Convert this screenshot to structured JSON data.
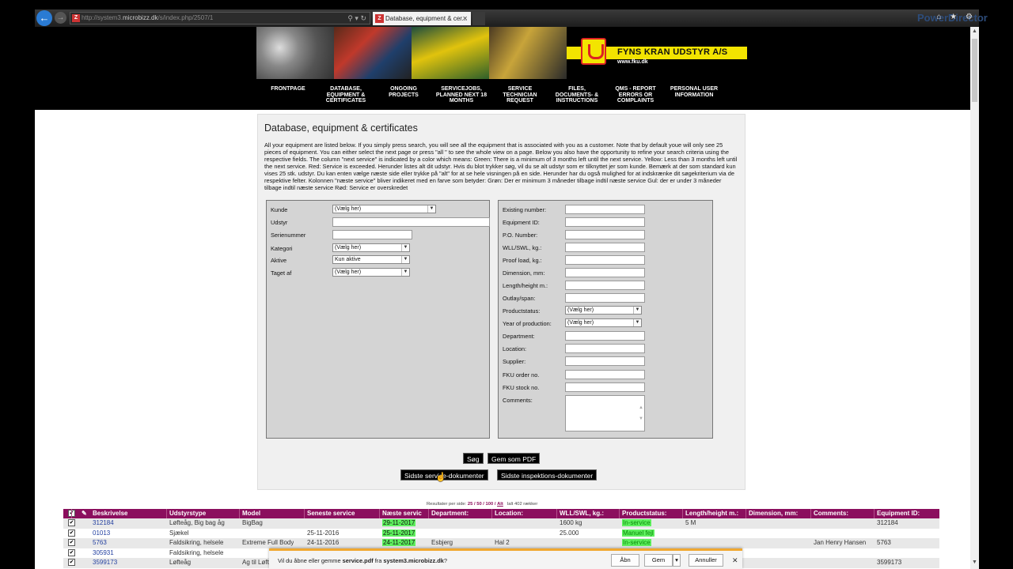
{
  "browser": {
    "url_prefix": "http://system3.",
    "url_domain": "microbizz.dk",
    "url_suffix": "/s/index.php/2507/1",
    "tab_title": "Database, equipment & cer...",
    "favicon": "Z",
    "tools_glyphs": "⚲ ▾ ↻",
    "close_glyph": "✕",
    "back_glyph": "←",
    "forward_glyph": "→",
    "chrome_icons": "⌂ ★ ⚙",
    "background_app_label": "PowerDirector"
  },
  "site": {
    "company_name": "FYNS KRAN UDSTYR A/S",
    "company_url": "www.fku.dk",
    "menu": [
      {
        "label": "FRONTPAGE"
      },
      {
        "label": "DATABASE, EQUIPMENT & CERTIFICATES"
      },
      {
        "label": "ONGOING PROJECTS"
      },
      {
        "label": "SERVICEJOBS, PLANNED NEXT 18 MONTHS"
      },
      {
        "label": "SERVICE TECHNICIAN REQUEST"
      },
      {
        "label": "FILES, DOCUMENTS- & INSTRUCTIONS"
      },
      {
        "label": "QMS - REPORT ERRORS OR COMPLAINTS"
      },
      {
        "label": "PERSONAL USER INFORMATION"
      }
    ]
  },
  "panel": {
    "title": "Database, equipment & certificates",
    "intro": "All your equipment are listed below. If you simply press search, you will see all the equipment that is associated with you as a customer. Note that by default youe will only see 25 pieces of equipment. You can either select the next page or press \"all \" to see the whole view on a page. Below you also have the opportunity to refine your search criteria using the respective fields. The column \"next service\" is indicated by a color which means: Green: There is a minimum of 3 months left until the next service. Yellow: Less than 3 months left until the next service. Red: Service is exceeded. Herunder listes alt dit udstyr. Hvis du blot trykker søg, vil du se alt udstyr som er tilknyttet jer som kunde. Bemærk at der som standard kun vises 25 stk. udstyr. Du kan enten vælge næste side eller trykke på \"alt\" for at se hele visningen på en side. Herunder har du også mulighed for at indskrænke dit søgekriterium via de respektive felter. Kolonnen \"næste service\" bliver indikeret med en farve som betyder: Grøn: Der er minimum 3 måneder tilbage indtil næste service Gul: der er under 3 måneder tilbage indtil næste service Rød: Service er overskredet"
  },
  "form_left": [
    {
      "label": "Kunde",
      "type": "select",
      "value": "(Vælg her)"
    },
    {
      "label": "Udstyr",
      "type": "input",
      "value": ""
    },
    {
      "label": "Serienummer",
      "type": "input",
      "value": ""
    },
    {
      "label": "Kategori",
      "type": "select",
      "value": "(Vælg her)"
    },
    {
      "label": "Aktive",
      "type": "select",
      "value": "Kun aktive"
    },
    {
      "label": "Taget af",
      "type": "select",
      "value": "(Vælg her)"
    }
  ],
  "form_right": [
    {
      "label": "Existing number:",
      "type": "input",
      "value": ""
    },
    {
      "label": "Equipment ID:",
      "type": "input",
      "value": ""
    },
    {
      "label": "P.O. Number:",
      "type": "input",
      "value": ""
    },
    {
      "label": "WLL/SWL, kg.:",
      "type": "input",
      "value": ""
    },
    {
      "label": "Proof load, kg.:",
      "type": "input",
      "value": ""
    },
    {
      "label": "Dimension, mm:",
      "type": "input",
      "value": ""
    },
    {
      "label": "Length/height m.:",
      "type": "input",
      "value": ""
    },
    {
      "label": "Outlay/span:",
      "type": "input",
      "value": ""
    },
    {
      "label": "Productstatus:",
      "type": "select",
      "value": "(Vælg her)"
    },
    {
      "label": "Year of production:",
      "type": "select",
      "value": "(Vælg her)"
    },
    {
      "label": "Department:",
      "type": "input",
      "value": ""
    },
    {
      "label": "Location:",
      "type": "input",
      "value": ""
    },
    {
      "label": "Supplier:",
      "type": "input",
      "value": ""
    },
    {
      "label": "FKU order no.",
      "type": "input",
      "value": ""
    },
    {
      "label": "FKU stock no.",
      "type": "input",
      "value": ""
    },
    {
      "label": "Comments:",
      "type": "textarea",
      "value": ""
    }
  ],
  "buttons": {
    "search": "Søg",
    "save_pdf": "Gem som PDF",
    "latest_service": "Sidste service-dokumenter",
    "latest_inspection": "Sidste inspektions-dokumenter"
  },
  "pager": {
    "prefix": "Resultater per side:",
    "options": [
      "25",
      "50",
      "100",
      "Alt"
    ],
    "separator": "/",
    "total": "Ialt 402 rækker"
  },
  "table": {
    "check_glyph": "✔",
    "edit_glyph": "✎",
    "columns": [
      "Beskrivelse",
      "Udstyrstype",
      "Model",
      "Seneste service",
      "Næste servic",
      "Department:",
      "Location:",
      "WLL/SWL, kg.:",
      "Productstatus:",
      "Length/height m.:",
      "Dimension, mm:",
      "Comments:",
      "Equipment ID:"
    ],
    "rows": [
      {
        "id": "312184",
        "type": "Løfteåg, Big bag åg",
        "model": "BigBag",
        "last": "",
        "next": "29-11-2017",
        "dept": "",
        "loc": "",
        "wll": "1600 kg",
        "status": "In-service",
        "length": "5 M",
        "dim": "",
        "comments": "",
        "equip_id": "312184"
      },
      {
        "id": "01013",
        "type": "Sjækel",
        "model": "",
        "last": "25-11-2016",
        "next": "25-11-2017",
        "dept": "",
        "loc": "",
        "wll": "25.000",
        "status": "Manuel fejl",
        "length": "",
        "dim": "",
        "comments": "",
        "equip_id": ""
      },
      {
        "id": "5763",
        "type": "Faldsikring, helsele",
        "model": "Extreme Full Body",
        "last": "24-11-2016",
        "next": "24-11-2017",
        "dept": "Esbjerg",
        "loc": "Hal 2",
        "wll": "",
        "status": "In-service",
        "length": "",
        "dim": "",
        "comments": "Jan Henry Hansen",
        "equip_id": "5763"
      },
      {
        "id": "305931",
        "type": "Faldsikring, helsele",
        "model": "",
        "last": "",
        "next": "",
        "dept": "",
        "loc": "",
        "wll": "",
        "status": "",
        "length": "",
        "dim": "",
        "comments": "",
        "equip_id": ""
      },
      {
        "id": "3599173",
        "type": "Løfteåg",
        "model": "Ag til Løft",
        "last": "",
        "next": "",
        "dept": "",
        "loc": "",
        "wll": "",
        "status": "",
        "length": "",
        "dim": "",
        "comments": "",
        "equip_id": "3599173"
      }
    ]
  },
  "download_bar": {
    "prefix": "Vil du åbne eller gemme",
    "file": "service.pdf",
    "middle": "fra",
    "host": "system3.microbizz.dk",
    "suffix": "?",
    "open": "Åbn",
    "save": "Gem",
    "cancel": "Annuller",
    "dropdown_glyph": "▾",
    "close_glyph": "✕"
  },
  "colors": {
    "brand_magenta": "#8b0f5e",
    "logo_yellow": "#f3e400",
    "logo_red": "#dd2222",
    "status_green": "#5ef05e",
    "download_accent": "#f0a830"
  },
  "icons": [
    "back-arrow-icon",
    "forward-arrow-icon",
    "favicon-z-icon",
    "home-icon",
    "star-icon",
    "gear-icon",
    "checkbox-icon",
    "edit-pencil-icon",
    "close-icon",
    "dropdown-arrow-icon",
    "hand-cursor-icon"
  ]
}
